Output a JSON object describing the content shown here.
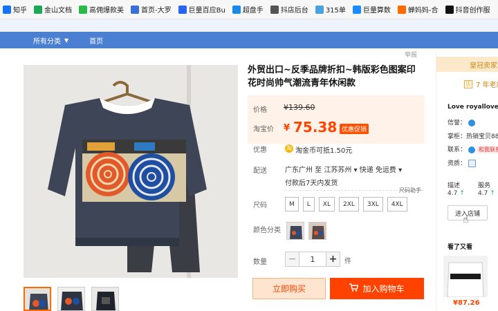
{
  "bookmarks": [
    {
      "label": "知乎",
      "color": "#1772f6",
      "icon": "zhihu-icon"
    },
    {
      "label": "金山文档",
      "color": "#1aaa55",
      "icon": "kdocs-icon"
    },
    {
      "label": "高佣爆款美",
      "color": "#2db84d",
      "icon": "cart-icon"
    },
    {
      "label": "首页-大罗",
      "color": "#3a6fd8",
      "icon": "globe-icon"
    },
    {
      "label": "巨量百应Bu",
      "color": "#2b64f0",
      "icon": "buyin-icon"
    },
    {
      "label": "超盘手",
      "color": "#1e88e5",
      "icon": "mail-icon"
    },
    {
      "label": "抖店后台",
      "color": "#555555",
      "icon": "doc-icon"
    },
    {
      "label": "315单",
      "color": "#4aa3df",
      "icon": "cloud-icon"
    },
    {
      "label": "巨量算数",
      "color": "#1a8cff",
      "icon": "stats-icon"
    },
    {
      "label": "蝉妈妈-合",
      "color": "#ff6a00",
      "icon": "chanmama-icon"
    },
    {
      "label": "抖音创作服",
      "color": "#111111",
      "icon": "douyin-icon"
    }
  ],
  "nav": {
    "all_categories": "所有分类",
    "home": "首页"
  },
  "report": "举报",
  "product": {
    "title": "外贸出口~反季品牌折扣~韩版彩色图案印花时尚帅气潮流青年休闲款",
    "price_label": "价格",
    "original_price": "¥139.60",
    "taobao_price_label": "淘宝价",
    "currency": "¥",
    "current_price": "75.38",
    "promo_tag": "优惠促销",
    "promo_label": "优惠",
    "coin_text": "淘金币可抵1.50元",
    "shipping_label": "配送",
    "shipping_text": "广东广州 至 江苏苏州 ▾   快递 免运费 ▾",
    "shipping_time": "付款后7天内发货",
    "size_help": "尺码助手",
    "size_label": "尺码",
    "sizes": [
      "M",
      "L",
      "XL",
      "2XL",
      "3XL",
      "4XL"
    ],
    "color_label": "颜色分类",
    "qty_label": "数量",
    "qty_minus": "−",
    "qty_value": "1",
    "qty_plus": "+",
    "qty_unit": "件",
    "buy_now": "立即购买",
    "add_to_cart": "加入购物车"
  },
  "shop": {
    "crown_text": "皇冠卖家",
    "years_badge": "店",
    "years_text": "7 年老店",
    "name": "Love royallove",
    "credit_label": "信誉：",
    "seller_label": "掌柜：",
    "seller_value": "热销宝贝88",
    "contact_label": "联系：",
    "contact_tag": "和我联系",
    "qualification_label": "资质：",
    "desc_label": "描述",
    "desc_value": "4.7",
    "service_label": "服务",
    "service_value": "4.7",
    "up_arrow": "↑",
    "enter_shop": "进入店铺",
    "see_also": "看了又看",
    "rec_price": "¥87.26"
  }
}
